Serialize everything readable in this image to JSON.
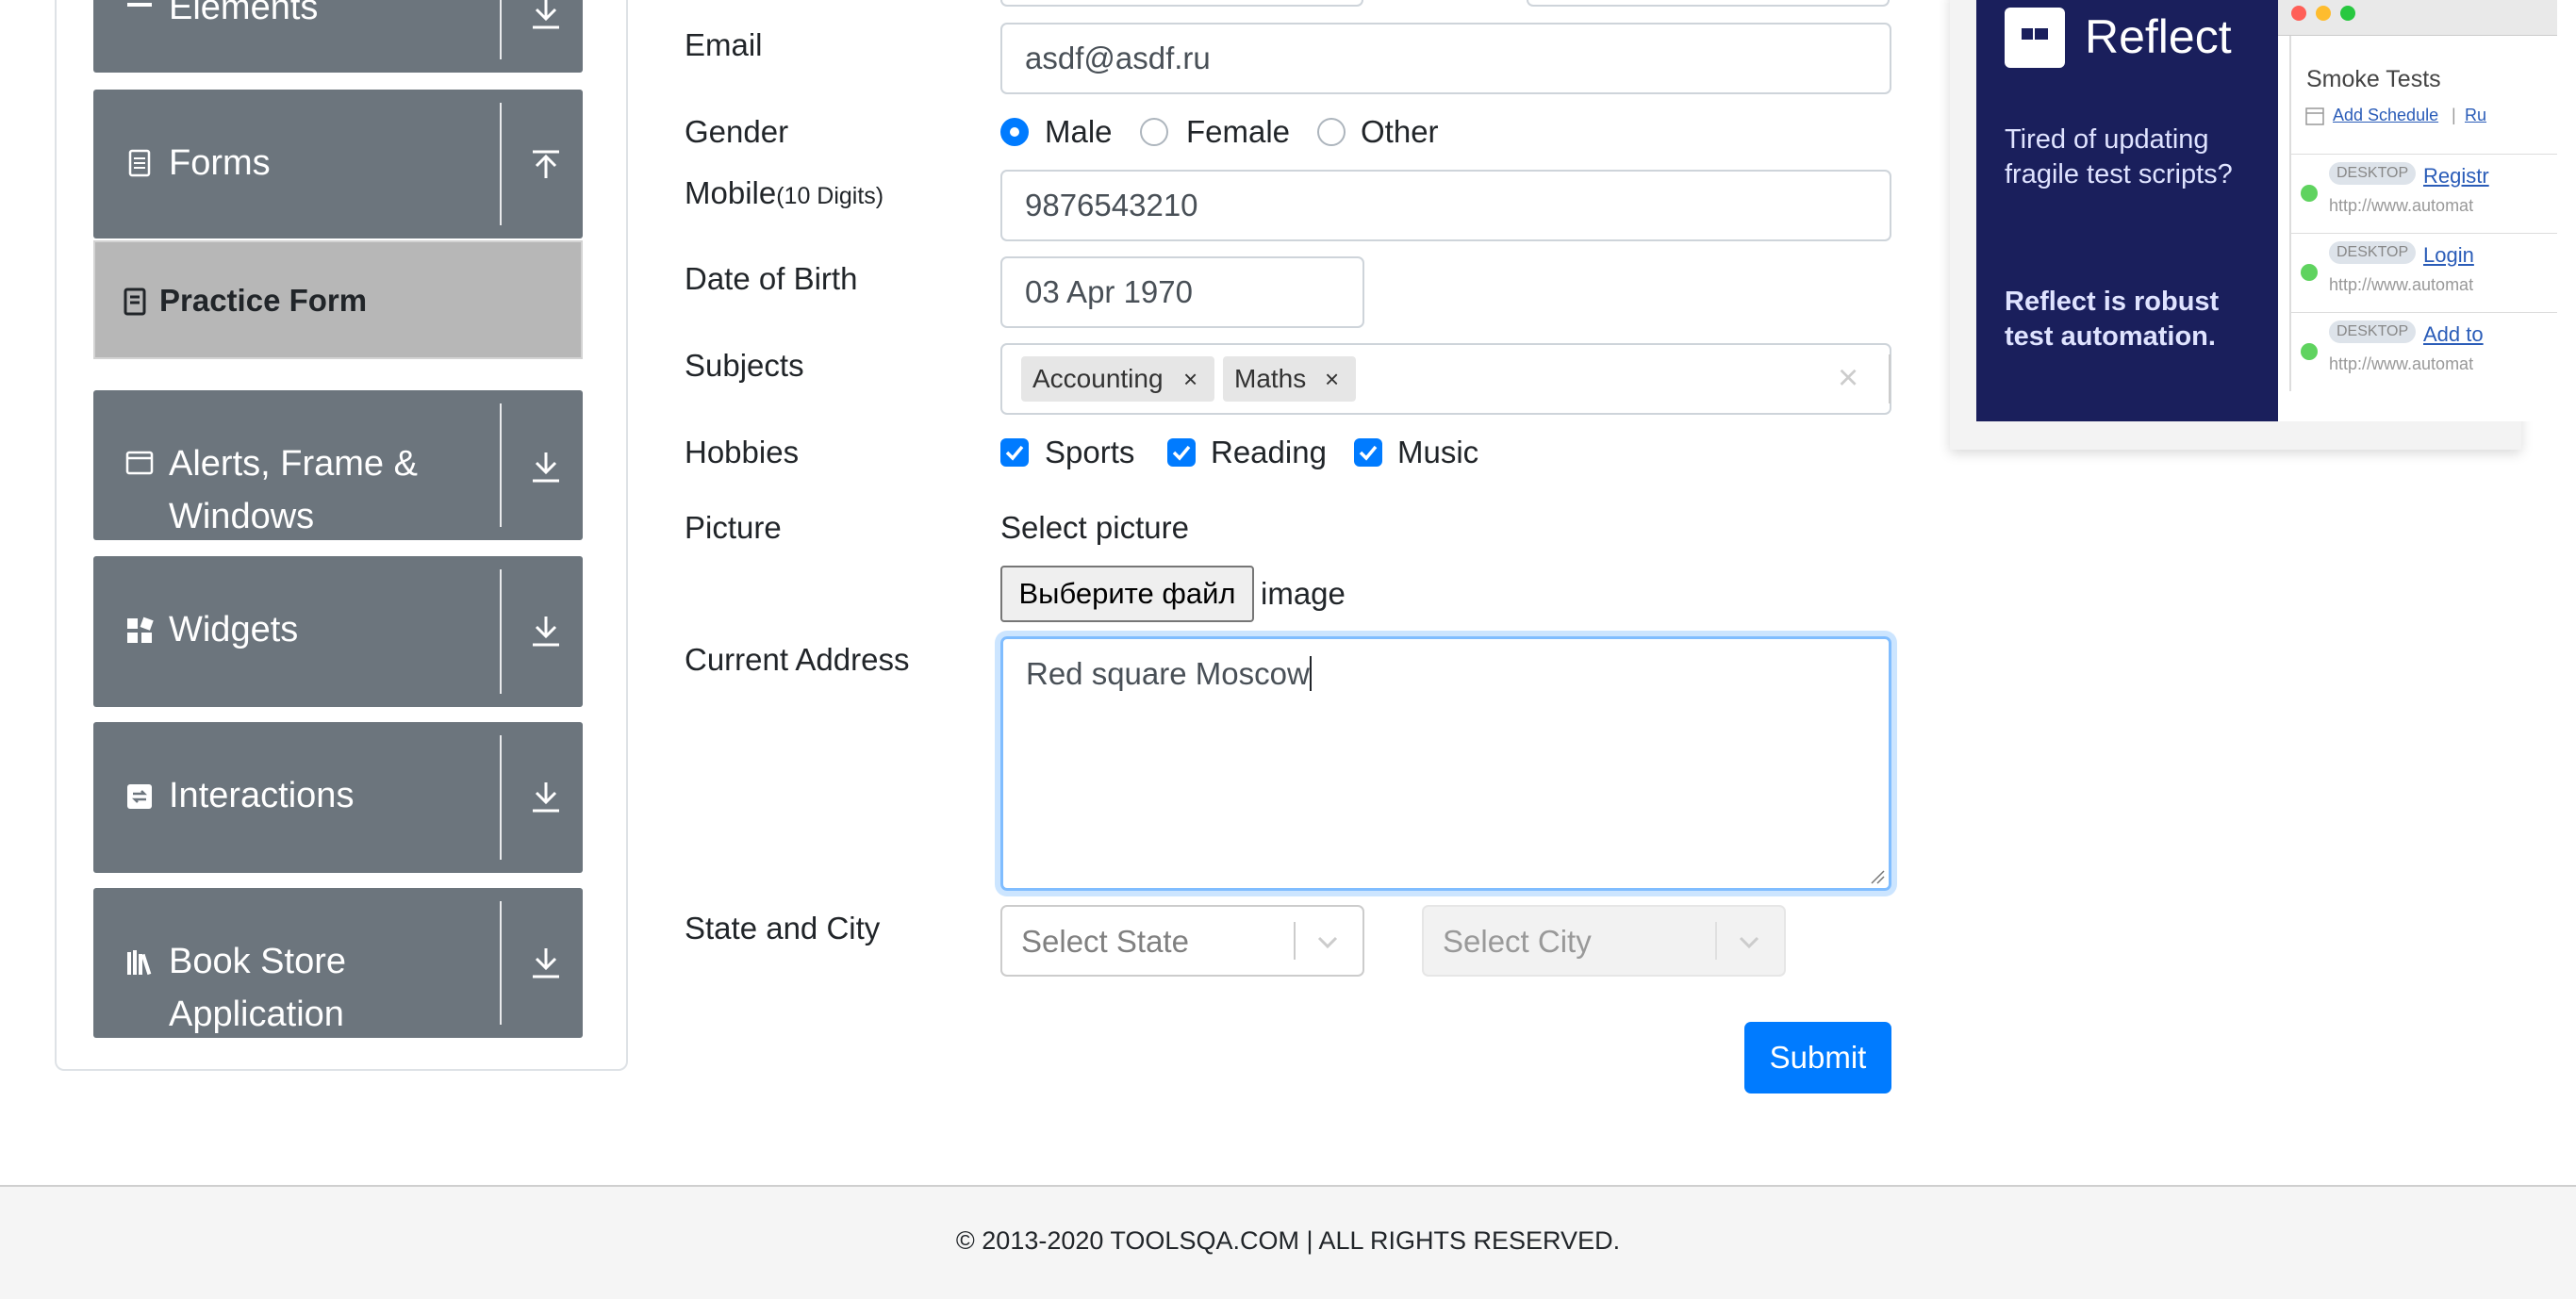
{
  "sidebar": {
    "groups": [
      {
        "label": "Elements"
      },
      {
        "label": "Forms"
      },
      {
        "label": "Alerts, Frame & Windows"
      },
      {
        "label": "Widgets"
      },
      {
        "label": "Interactions"
      },
      {
        "label": "Book Store Application"
      }
    ],
    "active_item": "Practice Form"
  },
  "form": {
    "email": {
      "label": "Email",
      "value": "asdf@asdf.ru"
    },
    "gender": {
      "label": "Gender",
      "options": [
        "Male",
        "Female",
        "Other"
      ],
      "selected": "Male"
    },
    "mobile": {
      "label": "Mobile",
      "label_suffix": "(10 Digits)",
      "value": "9876543210"
    },
    "dob": {
      "label": "Date of Birth",
      "value": "03 Apr 1970"
    },
    "subjects": {
      "label": "Subjects",
      "chips": [
        "Accounting",
        "Maths"
      ],
      "clear": "×",
      "remove": "×"
    },
    "hobbies": {
      "label": "Hobbies",
      "options": [
        "Sports",
        "Reading",
        "Music"
      ],
      "checked": [
        true,
        true,
        true
      ]
    },
    "picture": {
      "label": "Picture",
      "select_label": "Select picture",
      "button": "Выберите файл",
      "file_name": "image"
    },
    "address": {
      "label": "Current Address",
      "value": "Red square Moscow"
    },
    "state_city": {
      "label": "State and City",
      "state_placeholder": "Select State",
      "city_placeholder": "Select City"
    },
    "submit": "Submit"
  },
  "ad": {
    "brand": "Reflect",
    "line1": "Tired of updating fragile test scripts?",
    "line2": "Reflect is robust test automation.",
    "suite": "Smoke Tests",
    "add_schedule": "Add Schedule",
    "sep": "|",
    "run_link": "Ru",
    "rows": [
      {
        "tag": "DESKTOP",
        "name": "Registr",
        "url": "http://www.automat"
      },
      {
        "tag": "DESKTOP",
        "name": "Login",
        "url": "http://www.automat"
      },
      {
        "tag": "DESKTOP",
        "name": "Add to",
        "url": "http://www.automat"
      }
    ]
  },
  "footer": "© 2013-2020 TOOLSQA.COM | ALL RIGHTS RESERVED.",
  "colors": {
    "sidebar_group": "#6c757d",
    "primary": "#007bff",
    "ad_dark": "#1a1f5c"
  }
}
